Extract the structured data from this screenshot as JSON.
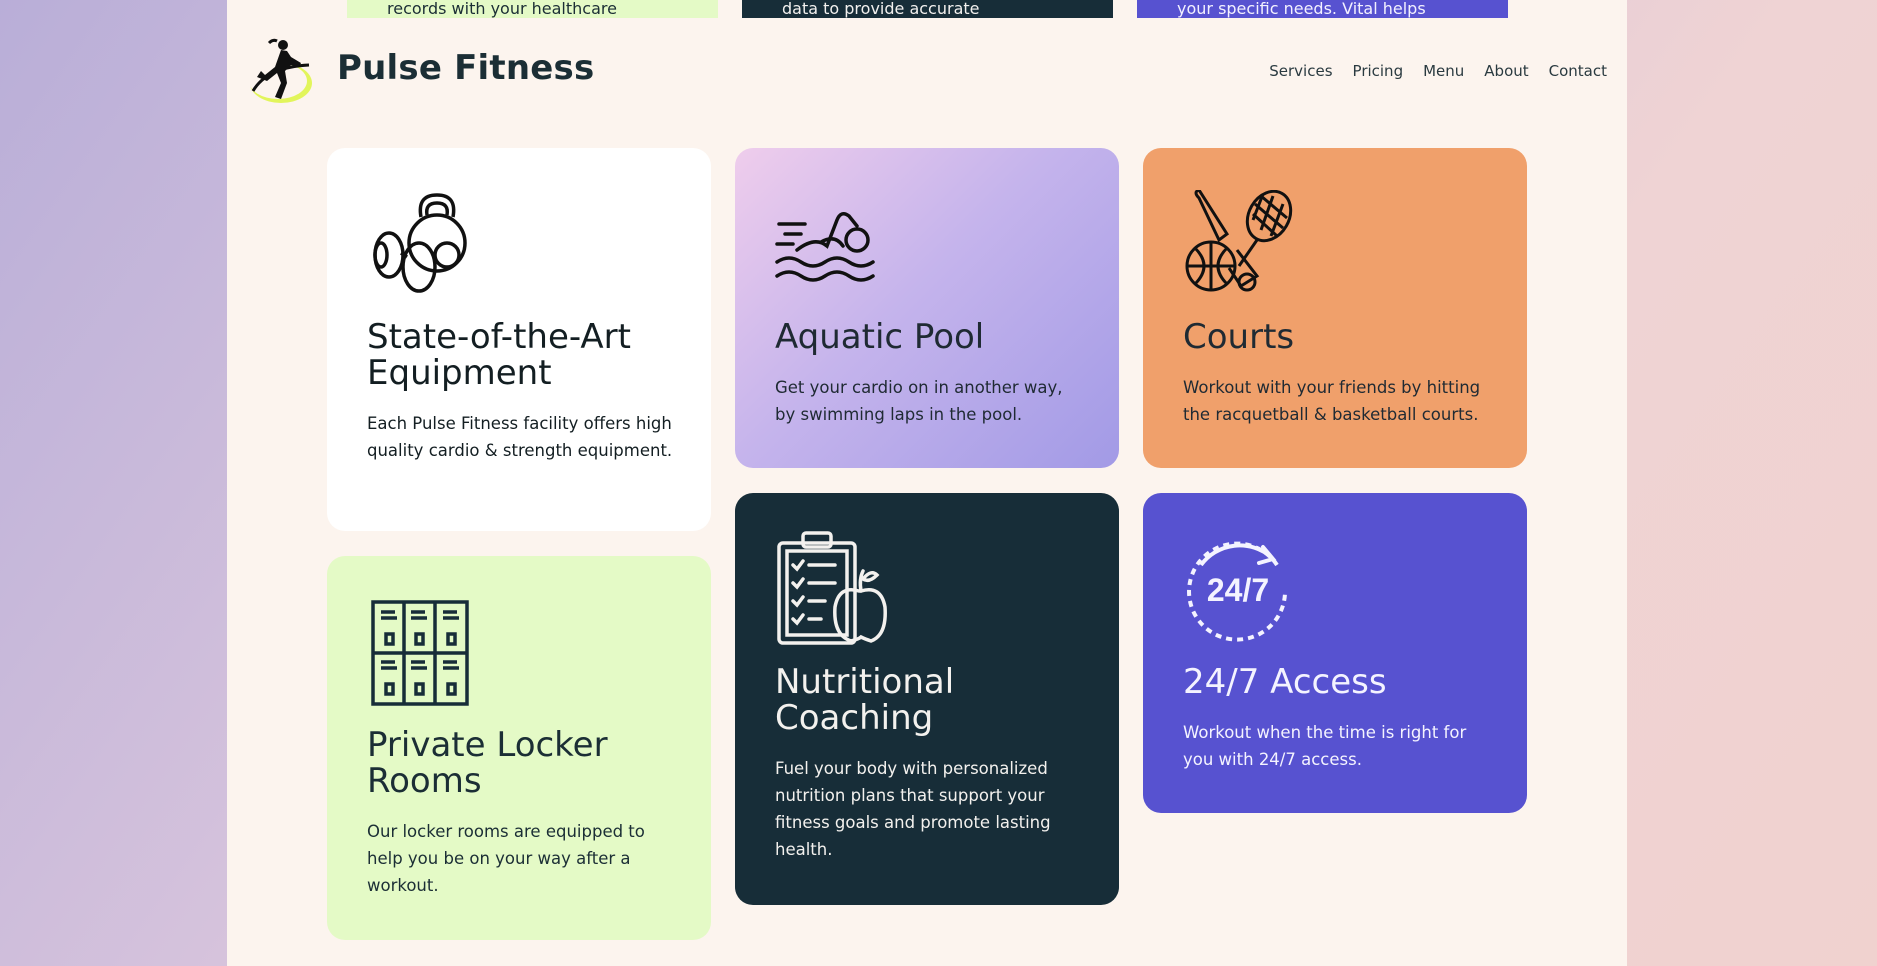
{
  "peek_cards": [
    {
      "text": "records with your healthcare"
    },
    {
      "text": "data to provide accurate"
    },
    {
      "text": "your specific needs. Vital helps"
    }
  ],
  "header": {
    "brand": "Pulse Fitness",
    "nav": [
      "Services",
      "Pricing",
      "Menu",
      "About",
      "Contact"
    ]
  },
  "cards": [
    {
      "icon": "dumbbell-kettlebell-icon",
      "title": "State-of-the-Art Equipment",
      "text": "Each Pulse Fitness facility offers high quality cardio & strength equipment."
    },
    {
      "icon": "swimmer-icon",
      "title": "Aquatic Pool",
      "text": "Get your cardio on in another way, by swimming laps in the pool."
    },
    {
      "icon": "racquet-ball-icon",
      "title": "Courts",
      "text": "Workout with your friends by hitting the racquetball & basketball courts."
    },
    {
      "icon": "lockers-icon",
      "title": "Private Locker Rooms",
      "text": "Our locker rooms are equipped to help you be on your way after a workout."
    },
    {
      "icon": "clipboard-apple-icon",
      "title": "Nutritional Coaching",
      "text": "Fuel your body with personalized nutrition plans that support your fitness goals and promote lasting health."
    },
    {
      "icon": "clock-24-7-icon",
      "title": "24/7 Access",
      "text": "Workout when the time is right for you with 24/7 access."
    }
  ],
  "access_icon_text": "24/7",
  "colors": {
    "background": "#fcf4ee",
    "dark": "#172d38",
    "lime": "#e4fac6",
    "orange": "#f0a06b",
    "indigo": "#5752d0",
    "lavender": "#c5b4ec"
  }
}
